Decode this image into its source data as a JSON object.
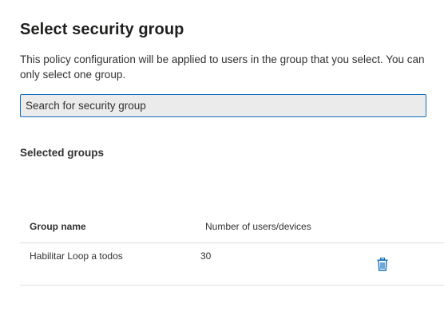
{
  "panel": {
    "title": "Select security group",
    "description": "This policy configuration will be applied to users in the group that you select. You can only select one group."
  },
  "search": {
    "placeholder": "Search for security group",
    "value": ""
  },
  "selected_groups": {
    "heading": "Selected groups",
    "columns": {
      "name": "Group name",
      "count": "Number of users/devices"
    },
    "rows": [
      {
        "name": "Habilitar Loop a todos",
        "count": "30",
        "action_icon": "trash-icon"
      }
    ]
  },
  "colors": {
    "accent": "#0f6cbd",
    "text": "#323130",
    "divider": "#e1dfdd",
    "search_bg": "#ebebeb"
  }
}
